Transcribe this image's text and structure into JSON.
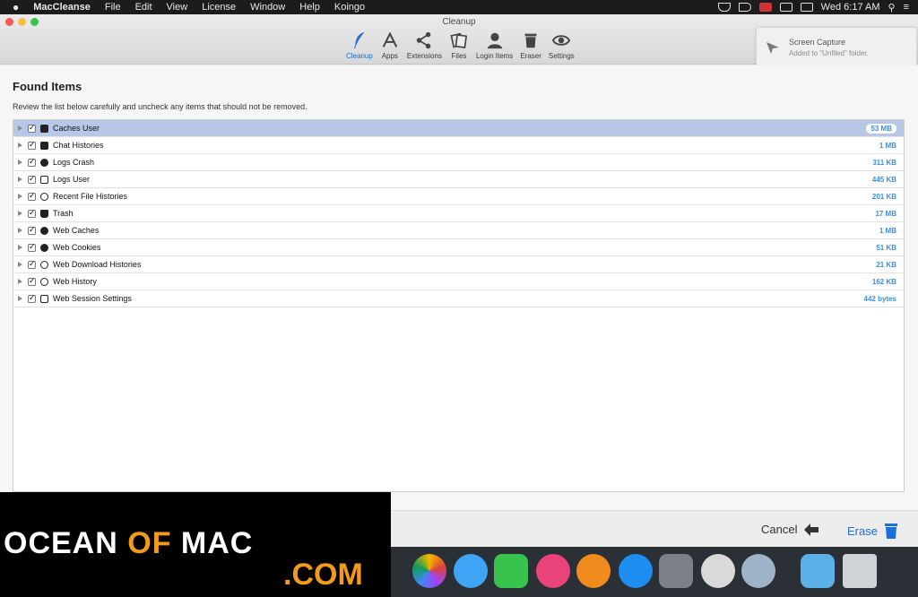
{
  "menubar": {
    "apple": "",
    "app": "MacCleanse",
    "items": [
      "File",
      "Edit",
      "View",
      "License",
      "Window",
      "Help",
      "Koingo"
    ],
    "clock": "Wed 6:17 AM"
  },
  "window": {
    "title": "Cleanup",
    "traffic": {
      "close": "#fc5753",
      "min": "#fdbc40",
      "max": "#33c748"
    }
  },
  "toolbar": [
    {
      "label": "Cleanup",
      "icon": "feather-icon",
      "active": true
    },
    {
      "label": "Apps",
      "icon": "apps-icon",
      "active": false
    },
    {
      "label": "Extensions",
      "icon": "share-icon",
      "active": false
    },
    {
      "label": "Files",
      "icon": "files-icon",
      "active": false
    },
    {
      "label": "Login Items",
      "icon": "user-icon",
      "active": false
    },
    {
      "label": "Eraser",
      "icon": "trash-icon",
      "active": false
    },
    {
      "label": "Settings",
      "icon": "eye-icon",
      "active": false
    }
  ],
  "notification": {
    "title": "Screen Capture",
    "subtitle": "Added to \"Unfiled\" folder."
  },
  "main": {
    "heading": "Found Items",
    "subtext": "Review the list below carefully and uncheck any items that should not be removed.",
    "items": [
      {
        "name": "Caches User",
        "size": "53 MB",
        "icon": "caches-icon",
        "selected": true
      },
      {
        "name": "Chat Histories",
        "size": "1 MB",
        "icon": "chat-icon",
        "selected": false
      },
      {
        "name": "Logs Crash",
        "size": "311 KB",
        "icon": "bug-icon",
        "selected": false
      },
      {
        "name": "Logs User",
        "size": "445 KB",
        "icon": "document-icon",
        "selected": false
      },
      {
        "name": "Recent File Histories",
        "size": "201 KB",
        "icon": "history-icon",
        "selected": false
      },
      {
        "name": "Trash",
        "size": "17 MB",
        "icon": "trash-icon",
        "selected": false
      },
      {
        "name": "Web Caches",
        "size": "1 MB",
        "icon": "globe-icon",
        "selected": false
      },
      {
        "name": "Web Cookies",
        "size": "51 KB",
        "icon": "info-icon",
        "selected": false
      },
      {
        "name": "Web Download Histories",
        "size": "21 KB",
        "icon": "download-icon",
        "selected": false
      },
      {
        "name": "Web History",
        "size": "162 KB",
        "icon": "clock-icon",
        "selected": false
      },
      {
        "name": "Web Session Settings",
        "size": "442 bytes",
        "icon": "session-icon",
        "selected": false
      }
    ]
  },
  "footer": {
    "cancel": "Cancel",
    "erase": "Erase"
  },
  "watermark": {
    "ocean": "OCEAN",
    "of": "OF",
    "mac": "MAC",
    "com": ".COM"
  },
  "dock": [
    "photos",
    "messages",
    "facetime",
    "itunes",
    "ibooks",
    "app-store",
    "system-preferences",
    "maccleanse",
    "automator",
    "downloads",
    "trash"
  ]
}
